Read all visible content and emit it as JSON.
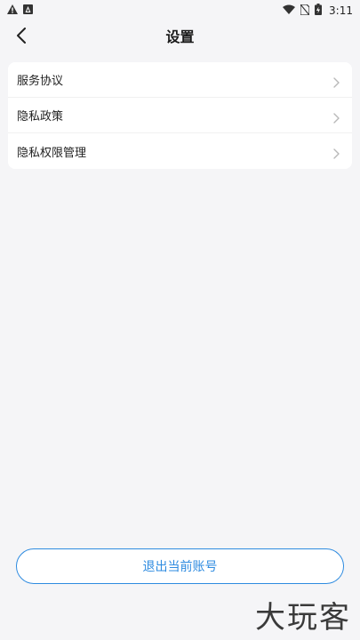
{
  "status_bar": {
    "time": "3:11",
    "left_icons": [
      "warning-icon",
      "android-notification-icon"
    ],
    "right_icons": [
      "wifi-icon",
      "no-sim-icon",
      "battery-icon"
    ]
  },
  "header": {
    "title": "设置",
    "back_icon": "chevron-left-icon"
  },
  "menu": {
    "items": [
      {
        "label": "服务协议"
      },
      {
        "label": "隐私政策"
      },
      {
        "label": "隐私权限管理"
      }
    ]
  },
  "logout": {
    "label": "退出当前账号"
  },
  "watermark": {
    "text": "大玩客"
  },
  "colors": {
    "accent": "#2e8be0",
    "background": "#f5f5f7",
    "card": "#ffffff"
  }
}
